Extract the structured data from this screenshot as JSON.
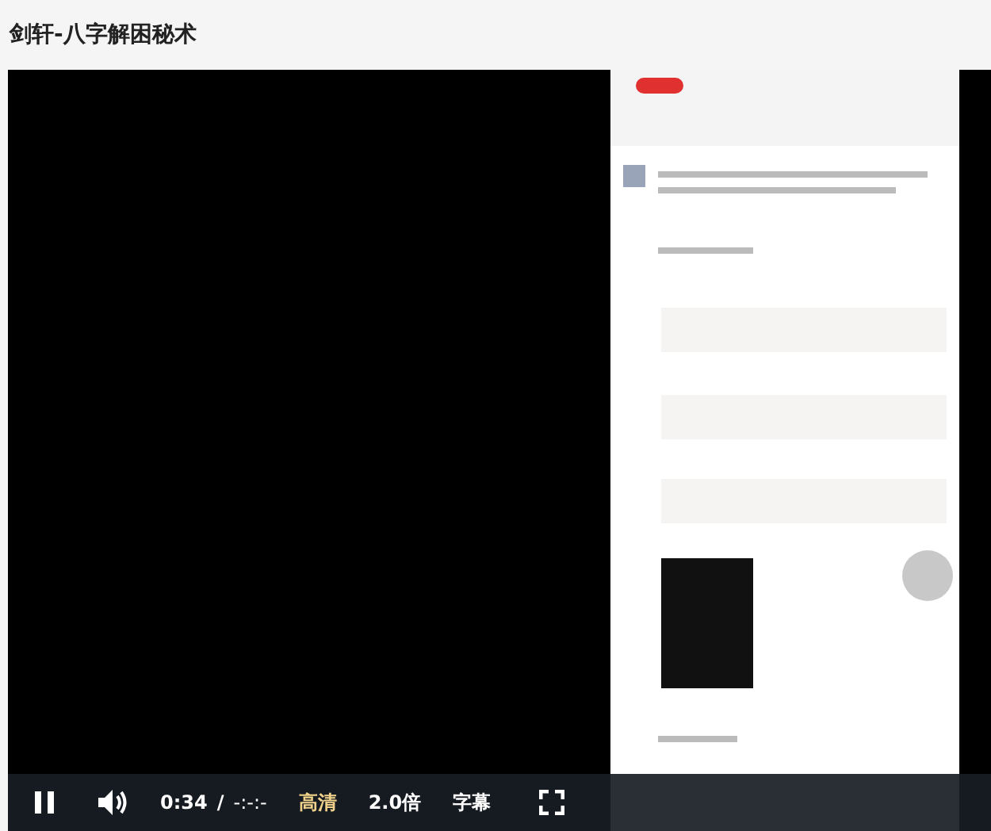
{
  "title": "剑轩-八字解困秘术",
  "video": {
    "playing": true,
    "time": "0:34",
    "separator": "/",
    "duration": "-:-:-",
    "buttons": [
      {
        "label": "高清",
        "highlighted": true
      },
      {
        "label": "2.0倍",
        "highlighted": false
      },
      {
        "label": "字幕",
        "highlighted": false
      }
    ]
  }
}
